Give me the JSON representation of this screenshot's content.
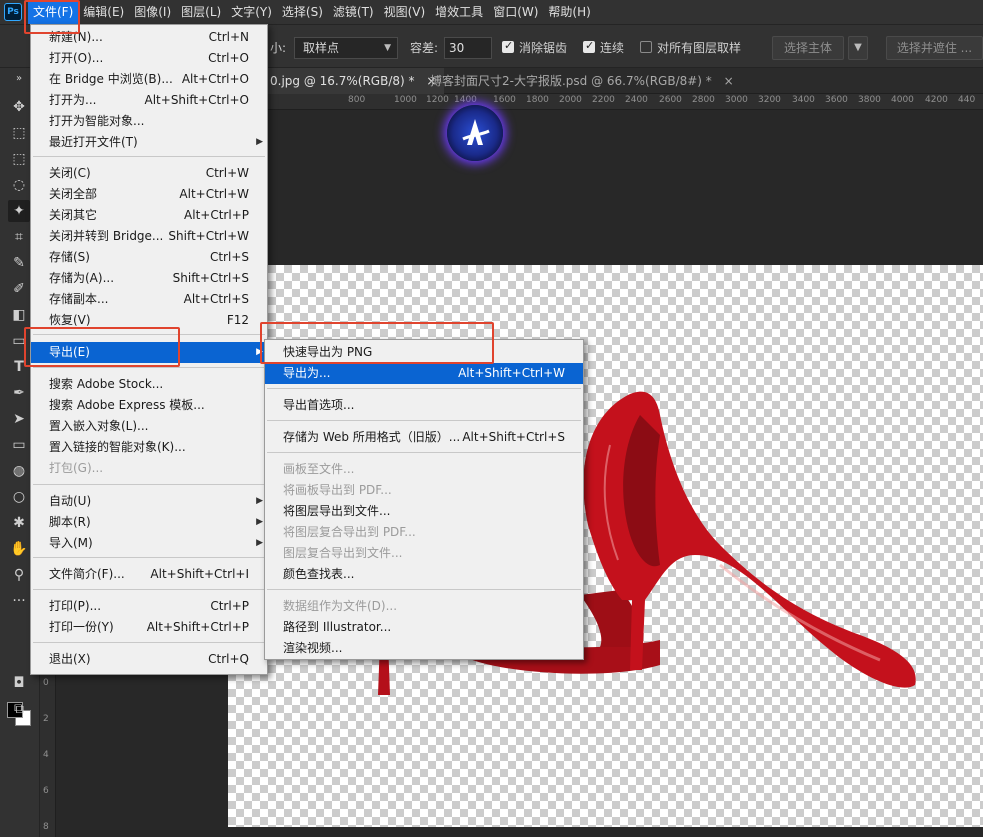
{
  "app": {
    "logo": "Ps"
  },
  "menubar": [
    "文件(F)",
    "编辑(E)",
    "图像(I)",
    "图层(L)",
    "文字(Y)",
    "选择(S)",
    "滤镜(T)",
    "视图(V)",
    "增效工具",
    "窗口(W)",
    "帮助(H)"
  ],
  "options": {
    "size_label": "小:",
    "sample_value": "取样点",
    "tolerance_label": "容差:",
    "tolerance_value": "30",
    "antialias_label": "消除锯齿",
    "contiguous_label": "连续",
    "all_layers_label": "对所有图层取样",
    "select_subject": "选择主体",
    "select_mask": "选择并遮住 ..."
  },
  "tabs": [
    "0.jpg @ 16.7%(RGB/8) *",
    "搏客封面尺寸2-大字报版.psd @ 66.7%(RGB/8#) *"
  ],
  "tab_close": "×",
  "ruler_top": [
    "800",
    "1000",
    "1200",
    "1400",
    "1600",
    "1800",
    "2000",
    "2200",
    "2400",
    "2600",
    "2800",
    "3000",
    "3200",
    "3400",
    "3600",
    "3800",
    "4000",
    "4200",
    "440"
  ],
  "ruler_left": [
    "0",
    "2",
    "4",
    "6",
    "8"
  ],
  "file_menu": [
    {
      "label": "新建(N)...",
      "shortcut": "Ctrl+N"
    },
    {
      "label": "打开(O)...",
      "shortcut": "Ctrl+O"
    },
    {
      "label": "在 Bridge 中浏览(B)...",
      "shortcut": "Alt+Ctrl+O"
    },
    {
      "label": "打开为...",
      "shortcut": "Alt+Shift+Ctrl+O"
    },
    {
      "label": "打开为智能对象...",
      "shortcut": ""
    },
    {
      "label": "最近打开文件(T)",
      "shortcut": ""
    },
    {
      "label": "关闭(C)",
      "shortcut": "Ctrl+W"
    },
    {
      "label": "关闭全部",
      "shortcut": "Alt+Ctrl+W"
    },
    {
      "label": "关闭其它",
      "shortcut": "Alt+Ctrl+P"
    },
    {
      "label": "关闭并转到 Bridge...",
      "shortcut": "Shift+Ctrl+W"
    },
    {
      "label": "存储(S)",
      "shortcut": "Ctrl+S"
    },
    {
      "label": "存储为(A)...",
      "shortcut": "Shift+Ctrl+S"
    },
    {
      "label": "存储副本...",
      "shortcut": "Alt+Ctrl+S"
    },
    {
      "label": "恢复(V)",
      "shortcut": "F12"
    },
    {
      "label": "导出(E)",
      "shortcut": ""
    },
    {
      "label": "搜索 Adobe Stock...",
      "shortcut": ""
    },
    {
      "label": "搜索 Adobe Express 模板...",
      "shortcut": ""
    },
    {
      "label": "置入嵌入对象(L)...",
      "shortcut": ""
    },
    {
      "label": "置入链接的智能对象(K)...",
      "shortcut": ""
    },
    {
      "label": "打包(G)...",
      "shortcut": ""
    },
    {
      "label": "自动(U)",
      "shortcut": ""
    },
    {
      "label": "脚本(R)",
      "shortcut": ""
    },
    {
      "label": "导入(M)",
      "shortcut": ""
    },
    {
      "label": "文件简介(F)...",
      "shortcut": "Alt+Shift+Ctrl+I"
    },
    {
      "label": "打印(P)...",
      "shortcut": "Ctrl+P"
    },
    {
      "label": "打印一份(Y)",
      "shortcut": "Alt+Shift+Ctrl+P"
    },
    {
      "label": "退出(X)",
      "shortcut": "Ctrl+Q"
    }
  ],
  "export_menu": [
    {
      "label": "快速导出为 PNG",
      "shortcut": ""
    },
    {
      "label": "导出为...",
      "shortcut": "Alt+Shift+Ctrl+W"
    },
    {
      "label": "导出首选项...",
      "shortcut": ""
    },
    {
      "label": "存储为 Web 所用格式（旧版）...",
      "shortcut": "Alt+Shift+Ctrl+S"
    },
    {
      "label": "画板至文件...",
      "shortcut": ""
    },
    {
      "label": "将画板导出到 PDF...",
      "shortcut": ""
    },
    {
      "label": "将图层导出到文件...",
      "shortcut": ""
    },
    {
      "label": "将图层复合导出到 PDF...",
      "shortcut": ""
    },
    {
      "label": "图层复合导出到文件...",
      "shortcut": ""
    },
    {
      "label": "颜色查找表...",
      "shortcut": ""
    },
    {
      "label": "数据组作为文件(D)...",
      "shortcut": ""
    },
    {
      "label": "路径到 Illustrator...",
      "shortcut": ""
    },
    {
      "label": "渲染视频...",
      "shortcut": ""
    }
  ],
  "colors": {
    "accent": "#1473e6",
    "highlight_box": "#e0442e",
    "shoe": "#c4111c"
  }
}
